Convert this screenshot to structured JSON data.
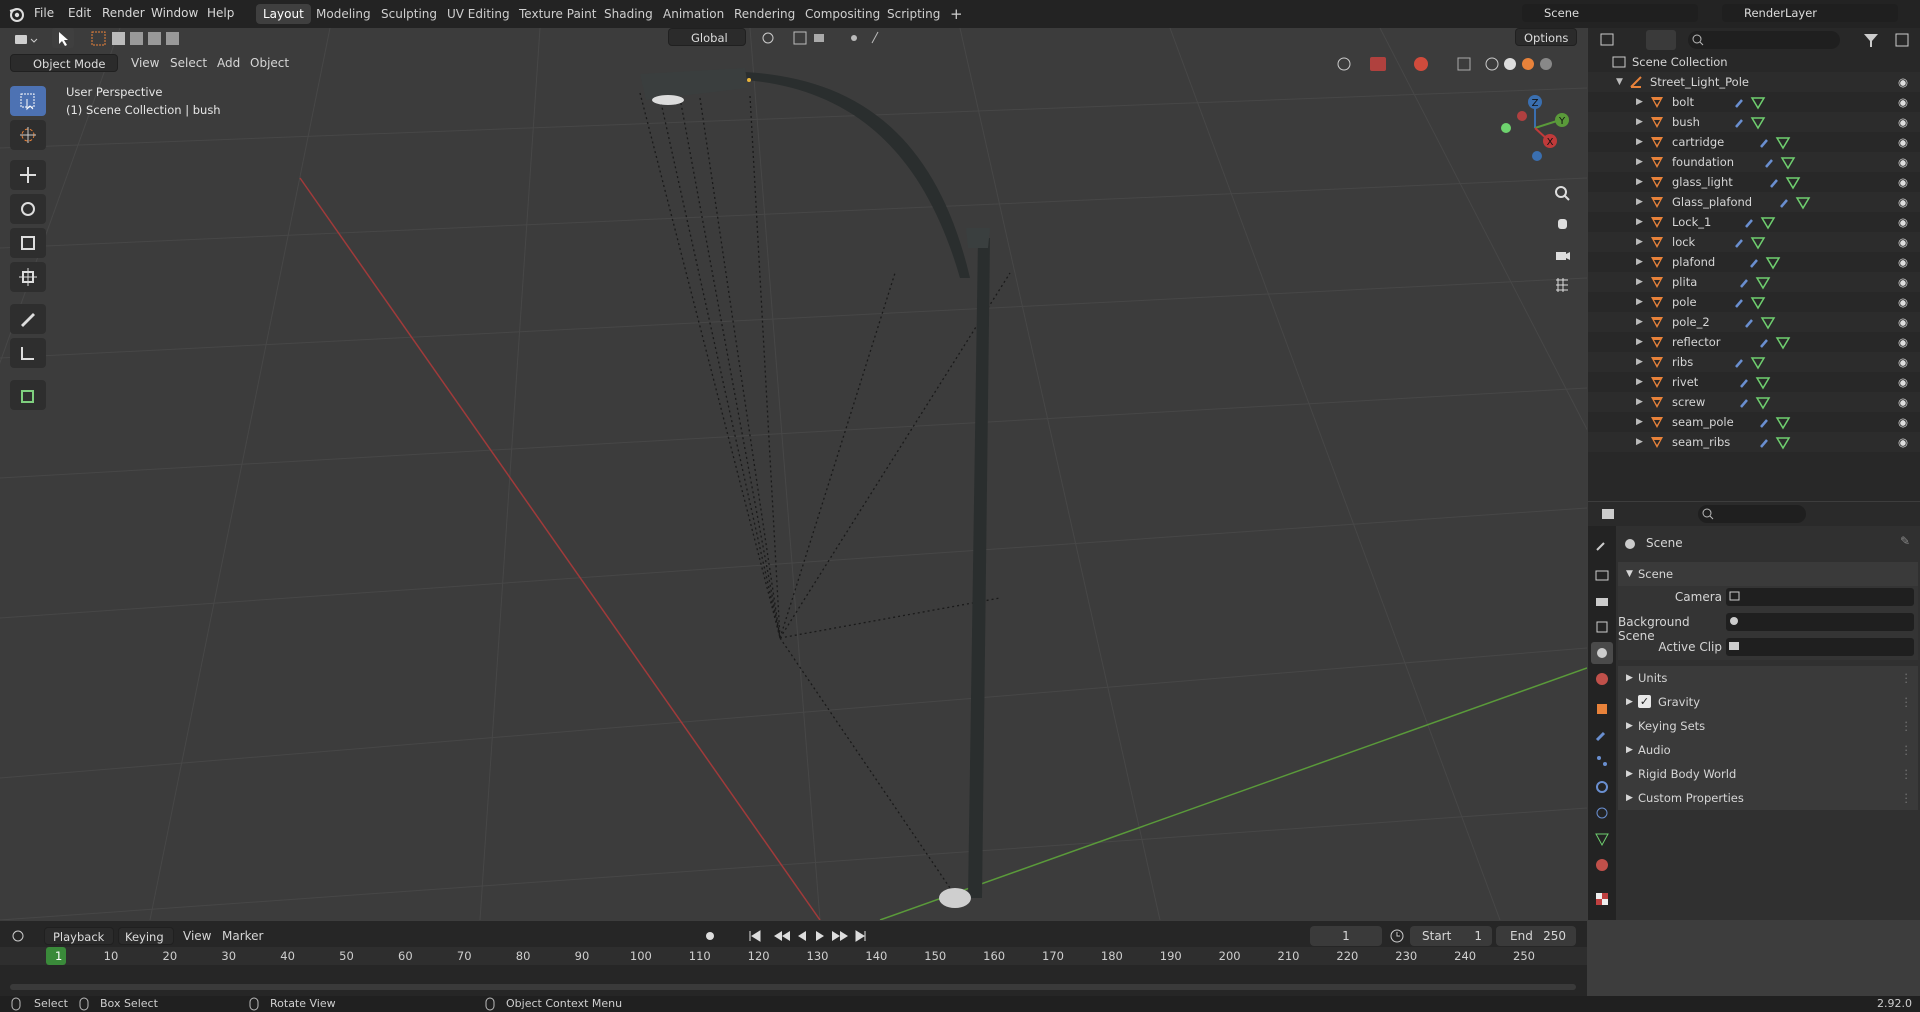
{
  "menu": {
    "file": "File",
    "edit": "Edit",
    "render": "Render",
    "window": "Window",
    "help": "Help"
  },
  "workspaces": [
    "Layout",
    "Modeling",
    "Sculpting",
    "UV Editing",
    "Texture Paint",
    "Shading",
    "Animation",
    "Rendering",
    "Compositing",
    "Scripting"
  ],
  "active_workspace": "Layout",
  "add_workspace": "+",
  "scene_field": "Scene",
  "renderlayer_field": "RenderLayer",
  "viewport_header": {
    "mode": "Object Mode",
    "menus": [
      "View",
      "Select",
      "Add",
      "Object"
    ],
    "orientation": "Global",
    "options": "Options"
  },
  "viewport_info": {
    "line1": "User Perspective",
    "line2": "(1) Scene Collection | bush"
  },
  "gizmo": {
    "z": "Z",
    "y": "Y",
    "x": "X"
  },
  "outliner": {
    "root": "Scene Collection",
    "collection": "Street_Light_Pole",
    "objects": [
      "bolt",
      "bush",
      "cartridge",
      "foundation",
      "glass_light",
      "Glass_plafond",
      "Lock_1",
      "lock",
      "plafond",
      "plita",
      "pole",
      "pole_2",
      "reflector",
      "ribs",
      "rivet",
      "screw",
      "seam_pole",
      "seam_ribs"
    ]
  },
  "properties": {
    "context": "Scene",
    "panel": "Scene",
    "camera_label": "Camera",
    "background_label": "Background Scene",
    "clip_label": "Active Clip",
    "subpanels": [
      "Units",
      "Gravity",
      "Keying Sets",
      "Audio",
      "Rigid Body World",
      "Custom Properties"
    ],
    "gravity_checked": true
  },
  "timeline": {
    "playback": "Playback",
    "keying": "Keying",
    "view": "View",
    "marker": "Marker",
    "current_frame": "1",
    "start_label": "Start",
    "start": "1",
    "end_label": "End",
    "end": "250",
    "ticks": [
      "1",
      "10",
      "20",
      "30",
      "40",
      "50",
      "60",
      "70",
      "80",
      "90",
      "100",
      "110",
      "120",
      "130",
      "140",
      "150",
      "160",
      "170",
      "180",
      "190",
      "200",
      "210",
      "220",
      "230",
      "240",
      "250"
    ]
  },
  "statusbar": {
    "select": "Select",
    "box_select": "Box Select",
    "rotate": "Rotate View",
    "context_menu": "Object Context Menu",
    "version": "2.92.0"
  },
  "colors": {
    "accent": "#4d72b3",
    "orange": "#e8823a",
    "axis_x": "#a03a3a",
    "axis_y": "#5a9a3a",
    "frame_green": "#3a8a3a"
  }
}
